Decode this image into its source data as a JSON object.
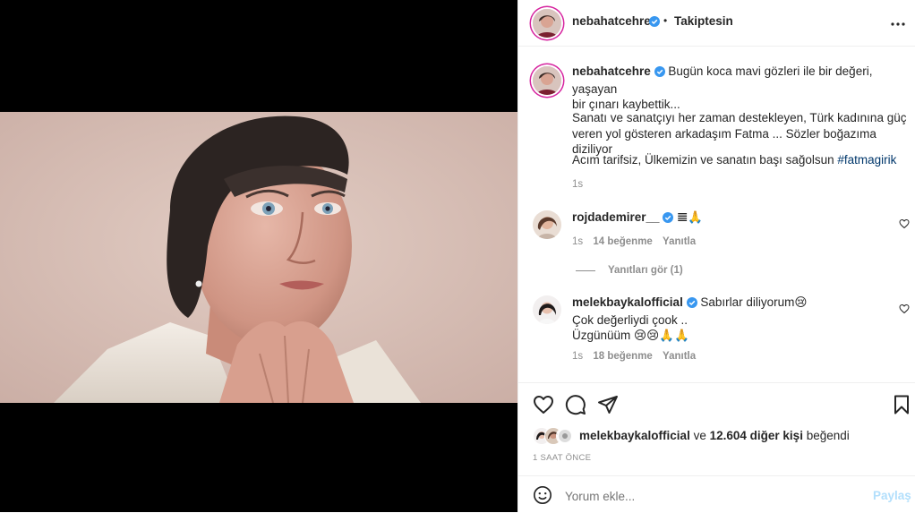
{
  "post": {
    "author": "nebahatcehre",
    "separator": "•",
    "follow_label": "Takiptesin",
    "caption_lines": [
      "Bugün koca mavi gözleri ile bir değeri, yaşayan",
      "bir çınarı kaybettik..."
    ],
    "caption_para2": [
      "Sanatı ve sanatçıyı her zaman destekleyen, Türk kadınına güç",
      "veren yol gösteren arkadaşım Fatma ... Sözler boğazıma diziliyor"
    ],
    "caption_para3_text": "Acım tarifsiz, Ülkemizin ve sanatın başı sağolsun ",
    "caption_hashtag": "#fatmagirik",
    "caption_time": "1s"
  },
  "comments": [
    {
      "user": "rojdademirer__",
      "text": "𝌆🙏",
      "time": "1s",
      "likes": "14 beğenme",
      "reply": "Yanıtla",
      "view_replies": "Yanıtları gör (1)"
    },
    {
      "user": "melekbaykalofficial",
      "text_line1": "Sabırlar diliyorum😢",
      "text_line2": "Çok değerliydi çook ..",
      "text_line3": "Üzgünüüm 😢😢🙏🙏",
      "time": "1s",
      "likes": "18 beğenme",
      "reply": "Yanıtla"
    }
  ],
  "likes_summary": {
    "user": "melekbaykalofficial",
    "conj": "ve",
    "count": "12.604 diğer kişi",
    "suffix": "beğendi"
  },
  "timestamp": "1 SAAT ÖNCE",
  "comment_box": {
    "placeholder": "Yorum ekle...",
    "submit": "Paylaş"
  },
  "colors": {
    "verified": "#3897f0",
    "link": "#00376b",
    "muted": "#8e8e8e",
    "submit_disabled": "#b2dffc"
  }
}
